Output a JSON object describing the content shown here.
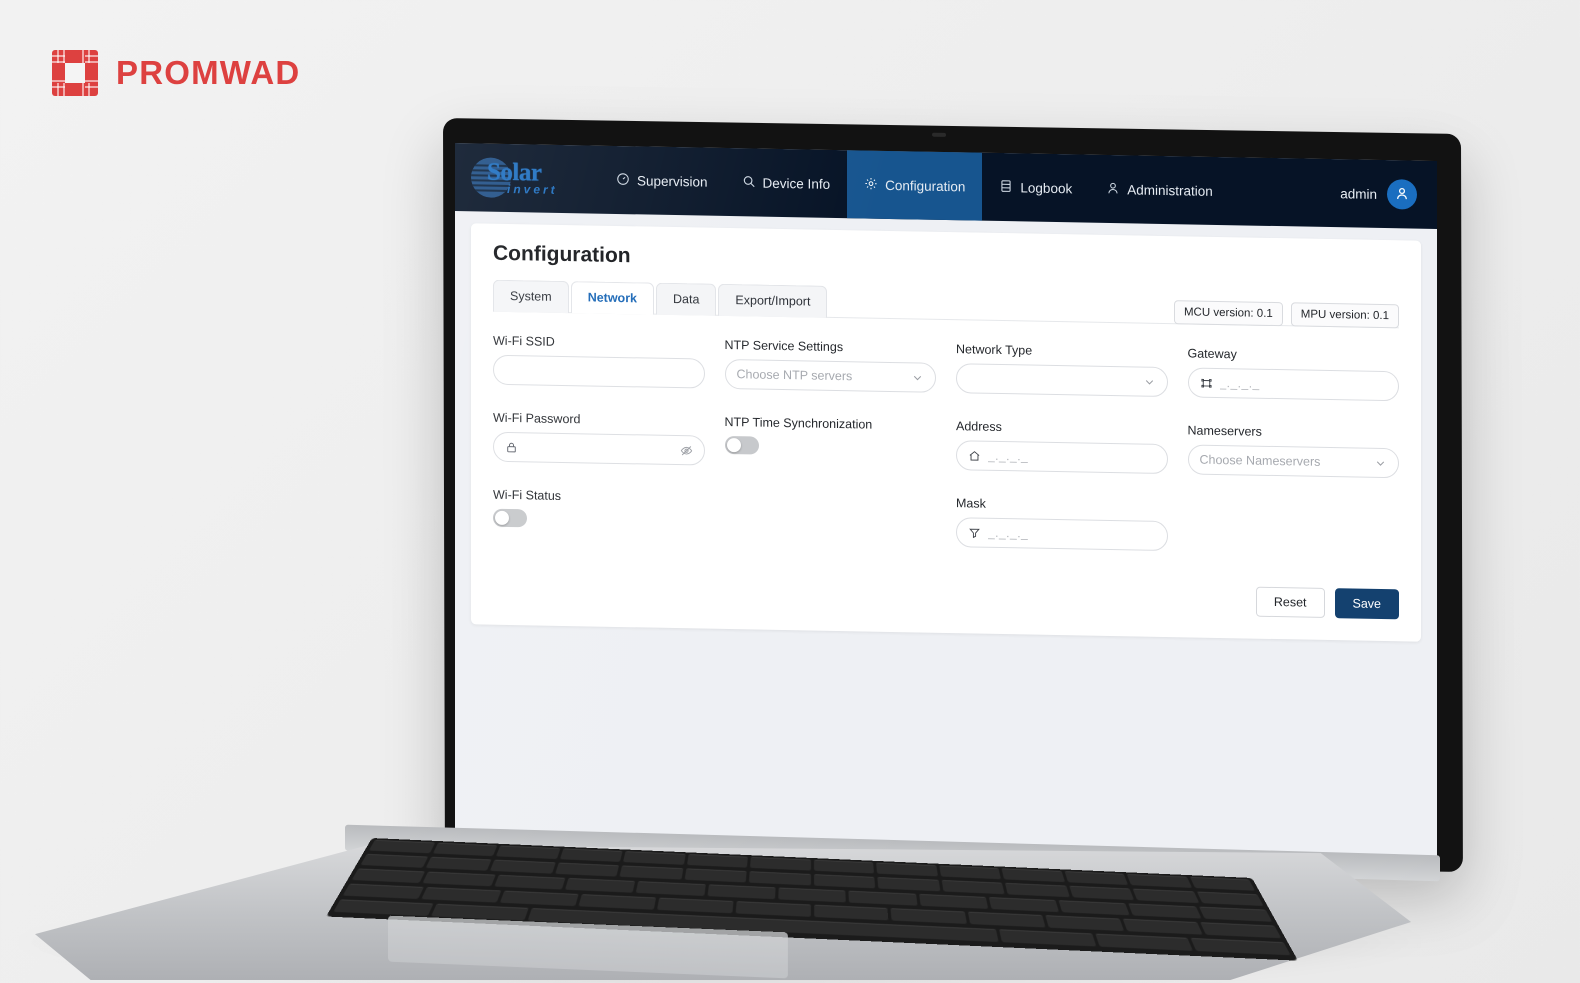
{
  "brand": {
    "name": "PROMWAD",
    "icon": "chip-icon",
    "color": "#dd4140"
  },
  "app": {
    "logo": {
      "primary": "Solar",
      "secondary": "invert",
      "icon": "sun-disc-icon"
    },
    "nav": {
      "items": [
        {
          "label": "Supervision",
          "icon": "gauge-icon",
          "active": false
        },
        {
          "label": "Device Info",
          "icon": "search-icon",
          "active": false
        },
        {
          "label": "Configuration",
          "icon": "gear-icon",
          "active": true
        },
        {
          "label": "Logbook",
          "icon": "book-icon",
          "active": false
        },
        {
          "label": "Administration",
          "icon": "user-icon",
          "active": false
        }
      ],
      "user": {
        "name": "admin",
        "avatar_icon": "user-avatar-icon"
      },
      "active_color": "#17558f",
      "background": "#061326"
    },
    "page": {
      "title": "Configuration",
      "tabs": [
        {
          "label": "System",
          "active": false
        },
        {
          "label": "Network",
          "active": true
        },
        {
          "label": "Data",
          "active": false
        },
        {
          "label": "Export/Import",
          "active": false
        }
      ],
      "badges": [
        {
          "label": "MCU version: 0.1"
        },
        {
          "label": "MPU version: 0.1"
        }
      ],
      "form": {
        "column1": [
          {
            "label": "Wi-Fi SSID",
            "type": "text",
            "value": "",
            "placeholder": "",
            "lead_icon": "",
            "trail_icon": ""
          },
          {
            "label": "Wi-Fi Password",
            "type": "password",
            "value": "",
            "placeholder": "",
            "lead_icon": "lock-icon",
            "trail_icon": "eye-off-icon"
          },
          {
            "label": "Wi-Fi Status",
            "type": "toggle",
            "value": "off"
          }
        ],
        "column2": [
          {
            "label": "NTP Service Settings",
            "type": "select",
            "value": "",
            "placeholder": "Choose NTP servers",
            "trail_icon": "chevron-down-icon"
          },
          {
            "label": "NTP Time Synchronization",
            "type": "toggle",
            "value": "off"
          }
        ],
        "column3": [
          {
            "label": "Network Type",
            "type": "select",
            "value": "",
            "placeholder": "",
            "trail_icon": "chevron-down-icon"
          },
          {
            "label": "Address",
            "type": "ip",
            "value": "_._._._",
            "lead_icon": "home-icon"
          },
          {
            "label": "Mask",
            "type": "ip",
            "value": "_._._._",
            "lead_icon": "filter-icon"
          }
        ],
        "column4": [
          {
            "label": "Gateway",
            "type": "ip",
            "value": "_._._._",
            "lead_icon": "gateway-icon"
          },
          {
            "label": "Nameservers",
            "type": "select",
            "value": "",
            "placeholder": "Choose Nameservers",
            "trail_icon": "chevron-down-icon"
          }
        ]
      },
      "actions": {
        "reset_label": "Reset",
        "save_label": "Save",
        "save_color": "#14416f"
      }
    }
  }
}
